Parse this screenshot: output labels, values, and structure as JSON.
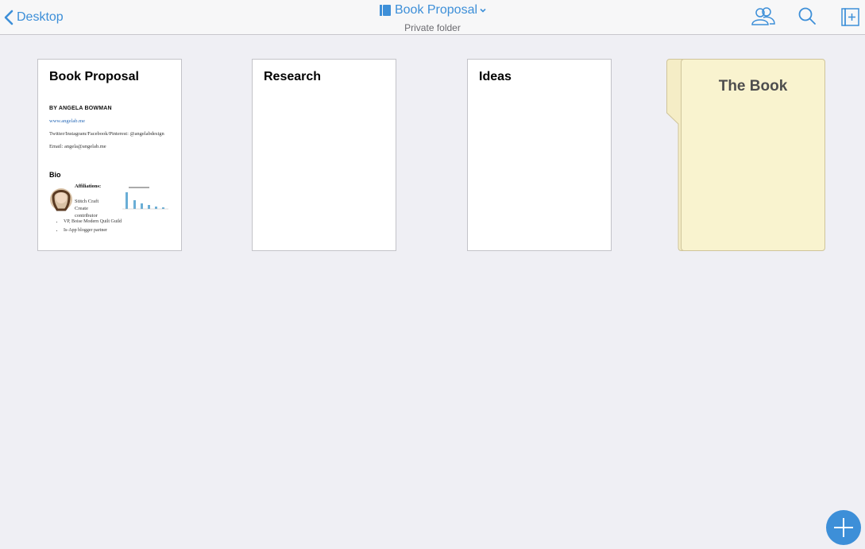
{
  "topbar": {
    "back_label": "Desktop",
    "title": "Book Proposal",
    "subtitle": "Private folder"
  },
  "cards": [
    {
      "title": "Book Proposal"
    },
    {
      "title": "Research"
    },
    {
      "title": "Ideas"
    }
  ],
  "preview": {
    "byline": "BY ANGELA BOWMAN",
    "website": "www.angelab.me",
    "social": "Twitter/Instagram/Facebook/Pinterest: @angelabdesign",
    "email": "Email: angela@angelab.me",
    "bio_heading": "Bio",
    "affiliations_label": "Affiliations:",
    "affiliations_text": "Stitch Craft Create contributor",
    "bullets": [
      "VP, Boise Modern Quilt Guild",
      "Is-App blogger partner"
    ]
  },
  "folder": {
    "title": "The Book"
  },
  "colors": {
    "accent": "#3d8fd8",
    "background": "#efeff4",
    "folder": "#f9f3cf"
  },
  "icons": [
    "chevron-left-icon",
    "notebook-icon",
    "caret-down-icon",
    "people-icon",
    "search-icon",
    "new-note-icon",
    "plus-icon"
  ]
}
